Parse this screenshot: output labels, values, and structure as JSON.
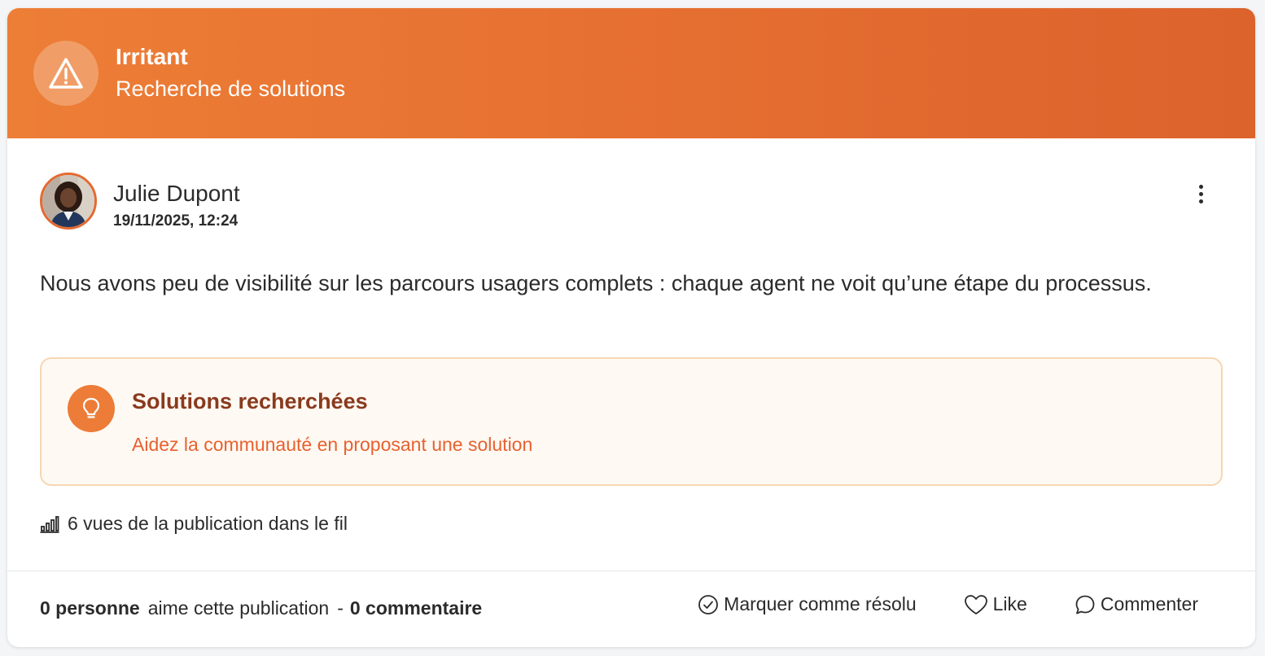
{
  "banner": {
    "icon": "warning-triangle-icon",
    "title": "Irritant",
    "subtitle": "Recherche de solutions",
    "gradient_start": "#ed7e36",
    "gradient_end": "#dc632c"
  },
  "post": {
    "author": "Julie Dupont",
    "date": "19/11/2025, 12:24",
    "avatar": "avatar-photo",
    "menu_icon": "more-vertical-icon",
    "text": "Nous avons peu de visibilité sur les parcours usagers complets : chaque agent ne voit qu’une étape du processus."
  },
  "solutions": {
    "icon": "lightbulb-icon",
    "title": "Solutions recherchées",
    "link": "Aidez la communauté en proposant une solution",
    "accent": "#ec7c37"
  },
  "views": {
    "icon": "bar-chart-icon",
    "text": "6 vues de la publication dans le fil"
  },
  "footer": {
    "likes_count": "0 personne",
    "likes_text": "aime cette publication",
    "separator": "-",
    "comments_count": "0 commentaire",
    "actions": {
      "resolve": "Marquer comme résolu",
      "like": "Like",
      "comment": "Commenter"
    }
  }
}
